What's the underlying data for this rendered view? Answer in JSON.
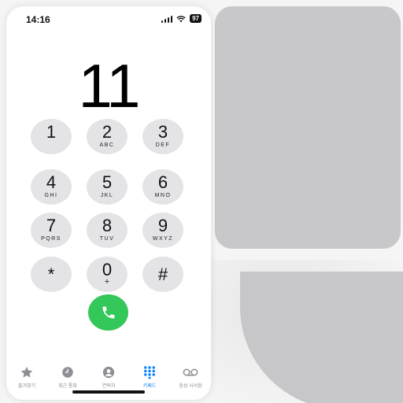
{
  "status": {
    "time": "14:16",
    "battery": "97"
  },
  "dialer": {
    "number": "11"
  },
  "keypad": {
    "keys": [
      {
        "digit": "1",
        "letters": ""
      },
      {
        "digit": "2",
        "letters": "ABC"
      },
      {
        "digit": "3",
        "letters": "DEF"
      },
      {
        "digit": "4",
        "letters": "GHI"
      },
      {
        "digit": "5",
        "letters": "JKL"
      },
      {
        "digit": "6",
        "letters": "MNO"
      },
      {
        "digit": "7",
        "letters": "PQRS"
      },
      {
        "digit": "8",
        "letters": "TUV"
      },
      {
        "digit": "9",
        "letters": "WXYZ"
      },
      {
        "digit": "*",
        "letters": ""
      },
      {
        "digit": "0",
        "letters": "+"
      },
      {
        "digit": "#",
        "letters": ""
      }
    ]
  },
  "call": {
    "icon": "phone-icon",
    "color": "#34c759"
  },
  "tabs": [
    {
      "label": "즐겨찾기",
      "icon": "star-icon",
      "active": false
    },
    {
      "label": "최근 통화",
      "icon": "clock-icon",
      "active": false
    },
    {
      "label": "연락처",
      "icon": "person-icon",
      "active": false
    },
    {
      "label": "키패드",
      "icon": "keypad-icon",
      "active": true
    },
    {
      "label": "음성 사서함",
      "icon": "voicemail-icon",
      "active": false
    }
  ],
  "colors": {
    "accent": "#0a84ff",
    "inactive": "#8e8e93",
    "key_background": "#e4e4e6"
  }
}
